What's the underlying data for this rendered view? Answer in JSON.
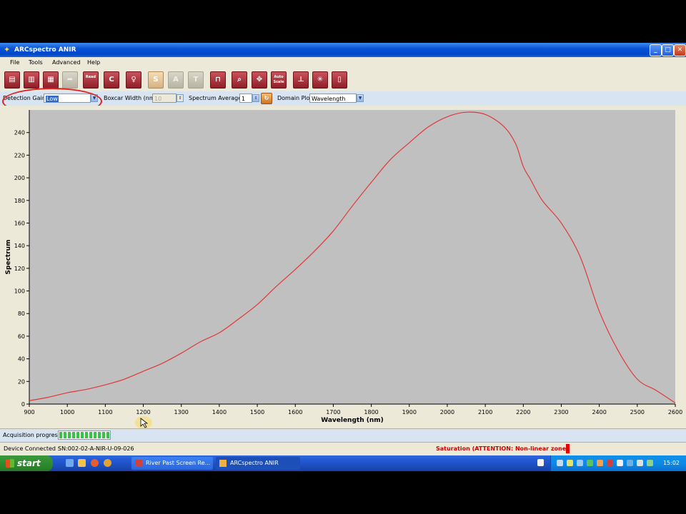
{
  "window": {
    "title": "ARCspectro ANIR",
    "minimize": "_",
    "maximize": "□",
    "close": "✕"
  },
  "menu": [
    "File",
    "Tools",
    "Advanced",
    "Help"
  ],
  "toolbar": {
    "buttons": [
      {
        "name": "open",
        "icon": "folder-icon",
        "glyph": "▤"
      },
      {
        "name": "save",
        "icon": "save-icon",
        "glyph": "▥"
      },
      {
        "name": "print",
        "icon": "print-icon",
        "glyph": "▦"
      },
      {
        "name": "export",
        "icon": "export-icon",
        "glyph": "➦",
        "disabled": true
      },
      {
        "name": "read",
        "icon": "read-icon",
        "label": "Read"
      },
      {
        "name": "continuous",
        "icon": "continuous-icon",
        "glyph": "C"
      },
      {
        "name": "lamp",
        "icon": "lamp-icon",
        "glyph": "♀"
      },
      {
        "name": "sample",
        "icon": "sample-icon",
        "glyph": "S",
        "style": "sat-s"
      },
      {
        "name": "absorbance",
        "icon": "absorbance-icon",
        "glyph": "A",
        "disabled": true
      },
      {
        "name": "transmittance",
        "icon": "transmittance-icon",
        "glyph": "T",
        "disabled": true
      },
      {
        "name": "peak",
        "icon": "peak-icon",
        "glyph": "⊓"
      },
      {
        "name": "zoom",
        "icon": "zoom-icon",
        "glyph": "⌕"
      },
      {
        "name": "pan",
        "icon": "pan-icon",
        "glyph": "✥"
      },
      {
        "name": "autoscale",
        "icon": "autoscale-icon",
        "label": "Auto Scale"
      },
      {
        "name": "cursor",
        "icon": "cursor-icon",
        "glyph": "⊥"
      },
      {
        "name": "settings",
        "icon": "settings-icon",
        "glyph": "✳"
      },
      {
        "name": "clear",
        "icon": "clear-icon",
        "glyph": "▯"
      }
    ]
  },
  "options": {
    "detection_gain_label": "Detection Gain :",
    "detection_gain_value": "Low",
    "boxcar_label": "Boxcar Width (nm)",
    "boxcar_value": "10",
    "average_label": "Spectrum Average",
    "average_value": "1",
    "domain_label": "Domain Plot",
    "domain_value": "Wavelength"
  },
  "chart_data": {
    "type": "line",
    "xlabel": "Wavelength (nm)",
    "ylabel": "Spectrum",
    "xlim": [
      900,
      2600
    ],
    "ylim": [
      0,
      260
    ],
    "xticks": [
      900,
      1000,
      1100,
      1200,
      1300,
      1400,
      1500,
      1600,
      1700,
      1800,
      1900,
      2000,
      2100,
      2200,
      2300,
      2400,
      2500,
      2600
    ],
    "yticks": [
      0,
      20,
      40,
      60,
      80,
      100,
      120,
      140,
      160,
      180,
      200,
      220,
      240
    ],
    "background": "#c0c0c0",
    "line_color": "#e03838",
    "series": [
      {
        "name": "",
        "x": [
          900,
          950,
          1000,
          1050,
          1100,
          1150,
          1200,
          1250,
          1300,
          1350,
          1400,
          1450,
          1500,
          1550,
          1600,
          1650,
          1700,
          1750,
          1800,
          1850,
          1900,
          1950,
          2000,
          2050,
          2100,
          2150,
          2180,
          2200,
          2220,
          2250,
          2300,
          2350,
          2400,
          2450,
          2500,
          2550,
          2600
        ],
        "y": [
          3,
          6,
          10,
          13,
          17,
          22,
          29,
          36,
          45,
          55,
          63,
          75,
          88,
          104,
          119,
          135,
          153,
          175,
          196,
          216,
          231,
          245,
          254,
          258,
          256,
          245,
          230,
          210,
          198,
          180,
          160,
          130,
          82,
          47,
          22,
          12,
          1
        ]
      }
    ]
  },
  "progress": {
    "label": "Acquisition progress",
    "value": 1.0
  },
  "status": {
    "device_label": "Device Connected :",
    "device_id": "SN:002-02-A-NIR-U-09-026",
    "saturation": "Saturation (ATTENTION: Non-linear zone)",
    "saturation_color": "#d10000"
  },
  "taskbar": {
    "start": "start",
    "tasks": [
      {
        "label": "River Past Screen Re...",
        "icon": "recorder-icon",
        "active": false
      },
      {
        "label": "ARCspectro ANIR",
        "icon": "spectro-icon",
        "active": true
      }
    ],
    "clock": "15:02"
  }
}
